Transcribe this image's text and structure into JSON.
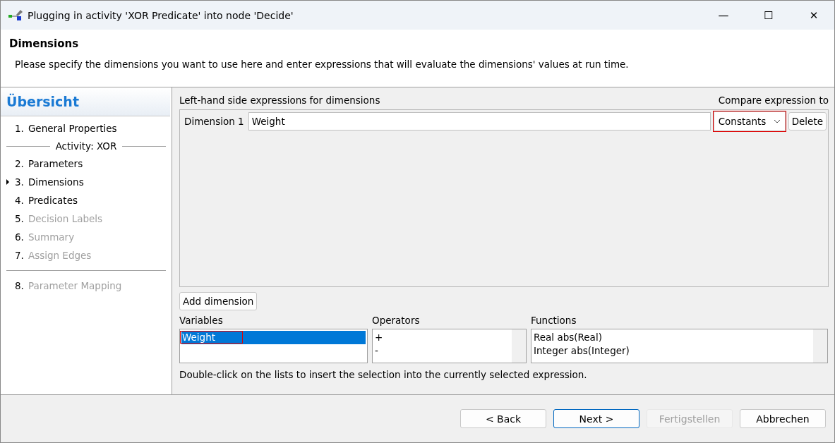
{
  "window": {
    "title": "Plugging in activity 'XOR Predicate' into node 'Decide'",
    "controls": [
      "—",
      "☐",
      "✕"
    ]
  },
  "header": {
    "title": "Dimensions",
    "description": "Please specify the dimensions you want to use here and enter expressions that will evaluate the dimensions' values at run time."
  },
  "sidebar": {
    "title": "Übersicht",
    "items": [
      {
        "kind": "step",
        "number": "1.",
        "label": "General Properties",
        "selected": false,
        "disabled": false
      },
      {
        "kind": "section",
        "label": "Activity: XOR"
      },
      {
        "kind": "step",
        "number": "2.",
        "label": "Parameters",
        "selected": false,
        "disabled": false
      },
      {
        "kind": "step",
        "number": "3.",
        "label": "Dimensions",
        "selected": true,
        "disabled": false
      },
      {
        "kind": "step",
        "number": "4.",
        "label": "Predicates",
        "selected": false,
        "disabled": false
      },
      {
        "kind": "step",
        "number": "5.",
        "label": "Decision Labels",
        "selected": false,
        "disabled": true
      },
      {
        "kind": "step",
        "number": "6.",
        "label": "Summary",
        "selected": false,
        "disabled": true
      },
      {
        "kind": "step",
        "number": "7.",
        "label": "Assign Edges",
        "selected": false,
        "disabled": true
      },
      {
        "kind": "divider"
      },
      {
        "kind": "step",
        "number": "8.",
        "label": "Parameter Mapping",
        "selected": false,
        "disabled": true
      }
    ]
  },
  "dimensions": {
    "heading": "Left-hand side expressions for dimensions",
    "compare_heading": "Compare expression to",
    "rows": [
      {
        "label": "Dimension 1",
        "value": "Weight",
        "compare": "Constants",
        "highlighted": true,
        "delete_label": "Delete"
      }
    ],
    "add_button": "Add dimension"
  },
  "lists": [
    {
      "title": "Variables",
      "items": [
        {
          "label": "Weight",
          "selected": true,
          "highlighted": true
        }
      ],
      "scrollbar": false
    },
    {
      "title": "Operators",
      "items": [
        {
          "label": "+",
          "selected": false,
          "highlighted": false
        },
        {
          "label": "-",
          "selected": false,
          "highlighted": false
        }
      ],
      "scrollbar": true
    },
    {
      "title": "Functions",
      "items": [
        {
          "label": "Real abs(Real)",
          "selected": false,
          "highlighted": false
        },
        {
          "label": "Integer abs(Integer)",
          "selected": false,
          "highlighted": false
        }
      ],
      "scrollbar": true
    }
  ],
  "hint": "Double-click on the lists to insert the selection into the currently selected expression.",
  "buttons": [
    {
      "label": "< Back",
      "default": false,
      "disabled": false
    },
    {
      "label": "Next >",
      "default": true,
      "disabled": false
    },
    {
      "label": "Fertigstellen",
      "default": false,
      "disabled": true
    },
    {
      "label": "Abbrechen",
      "default": false,
      "disabled": false
    }
  ]
}
